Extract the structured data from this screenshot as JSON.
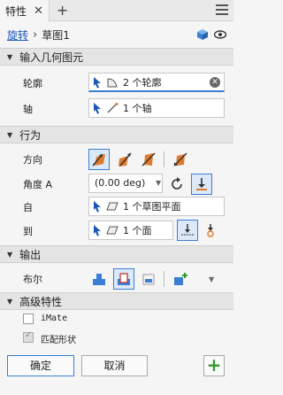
{
  "tab": {
    "title": "特性",
    "close": "✕",
    "add": "+"
  },
  "breadcrumb": {
    "link": "旋转",
    "separator": "›",
    "current": "草图1"
  },
  "sections": {
    "input": "输入几何图元",
    "behavior": "行为",
    "output": "输出",
    "advanced": "高级特性"
  },
  "input": {
    "profile_label": "轮廓",
    "profile_value": "2 个轮廓",
    "axis_label": "轴",
    "axis_value": "1 个轴"
  },
  "behavior": {
    "direction_label": "方向",
    "angle_label": "角度 A",
    "angle_value": "(0.00 deg)",
    "from_label": "自",
    "from_value": "1 个草图平面",
    "to_label": "到",
    "to_value": "1 个面"
  },
  "output": {
    "boolean_label": "布尔"
  },
  "advanced": {
    "imate_label": "iMate",
    "match_shape_label": "匹配形状",
    "imate_checked": false,
    "match_shape_checked": true
  },
  "footer": {
    "ok": "确定",
    "cancel": "取消",
    "add": "+"
  },
  "colors": {
    "accent": "#3a7fd5",
    "link": "#1a57b8",
    "green": "#2e9b2e",
    "orange": "#e07a2e"
  }
}
